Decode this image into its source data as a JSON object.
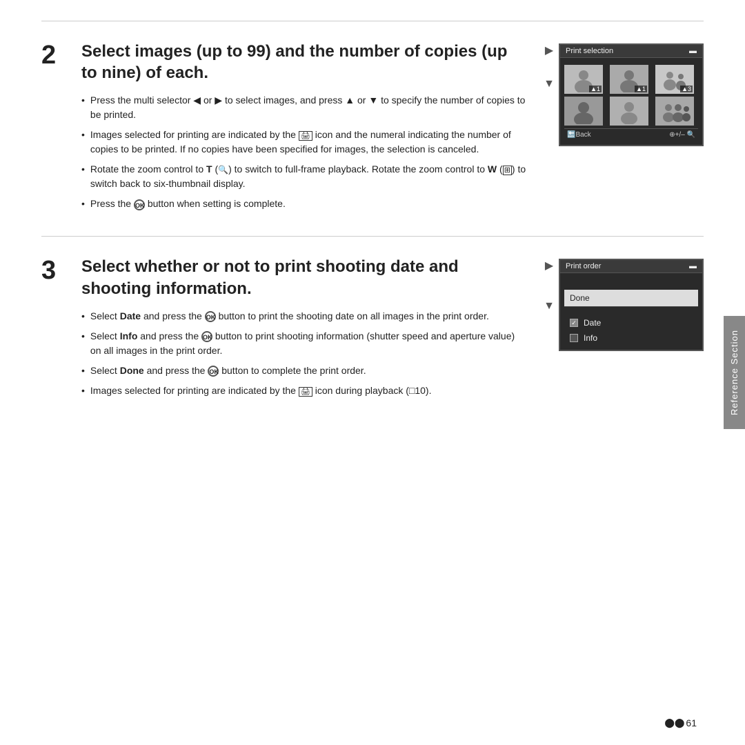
{
  "page": {
    "background": "#ffffff"
  },
  "section2": {
    "number": "2",
    "heading": "Select images (up to 99) and the number of copies (up to nine) of each.",
    "bullets": [
      {
        "id": "b2-1",
        "text": "Press the multi selector ◀ or ▶ to select images, and press ▲ or ▼ to specify the number of copies to be printed."
      },
      {
        "id": "b2-2",
        "text": "Images selected for printing are indicated by the 🖨 icon and the numeral indicating the number of copies to be printed. If no copies have been specified for images, the selection is canceled."
      },
      {
        "id": "b2-3",
        "text": "Rotate the zoom control to T (🔍) to switch to full-frame playback. Rotate the zoom control to W (⊞) to switch back to six-thumbnail display."
      },
      {
        "id": "b2-4",
        "text": "Press the ⓪K button when setting is complete."
      }
    ],
    "screen": {
      "title": "Print selection",
      "back_label": "🔙Back",
      "zoom_label": "⊕+/– 🔍"
    }
  },
  "section3": {
    "number": "3",
    "heading": "Select whether or not to print shooting date and shooting information.",
    "bullets": [
      {
        "id": "b3-1",
        "text": "Select Date and press the ⓪K button to print the shooting date on all images in the print order."
      },
      {
        "id": "b3-2",
        "text": "Select Info and press the ⓪K button to print shooting information (shutter speed and aperture value) on all images in the print order."
      },
      {
        "id": "b3-3",
        "text": "Select Done and press the ⓪K button to complete the print order."
      },
      {
        "id": "b3-4",
        "text": "Images selected for printing are indicated by the 🖨 icon during playback (□10)."
      }
    ],
    "screen": {
      "title": "Print order",
      "items": [
        {
          "label": "Done",
          "highlighted": true
        },
        {
          "label": "",
          "highlighted": false
        }
      ],
      "checkboxes": [
        {
          "label": "Date",
          "checked": true
        },
        {
          "label": "Info",
          "checked": false
        }
      ]
    }
  },
  "sidebar": {
    "label": "Reference Section"
  },
  "footer": {
    "page_number": "61",
    "icon": "📷"
  }
}
